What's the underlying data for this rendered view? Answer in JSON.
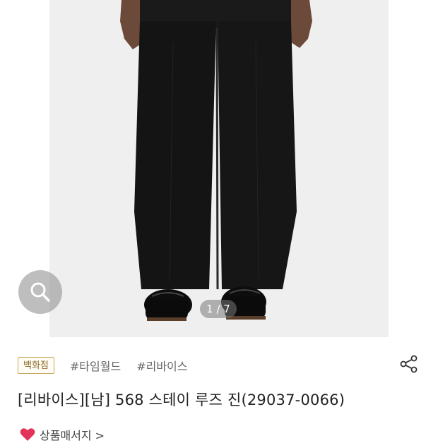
{
  "gallery": {
    "counter": "1 / 7",
    "current_index": 1,
    "total": 7,
    "zoom_icon": "search-icon"
  },
  "product": {
    "badge": "백화점",
    "hashtags": [
      "#타임월드",
      "#리바이스"
    ],
    "title": "[리바이스][남] 568 스테이 루즈 진(29037-0066)",
    "share_icon": "share-icon"
  },
  "store": {
    "name": "상품매서지 >",
    "heart_color": "#e2345a"
  }
}
